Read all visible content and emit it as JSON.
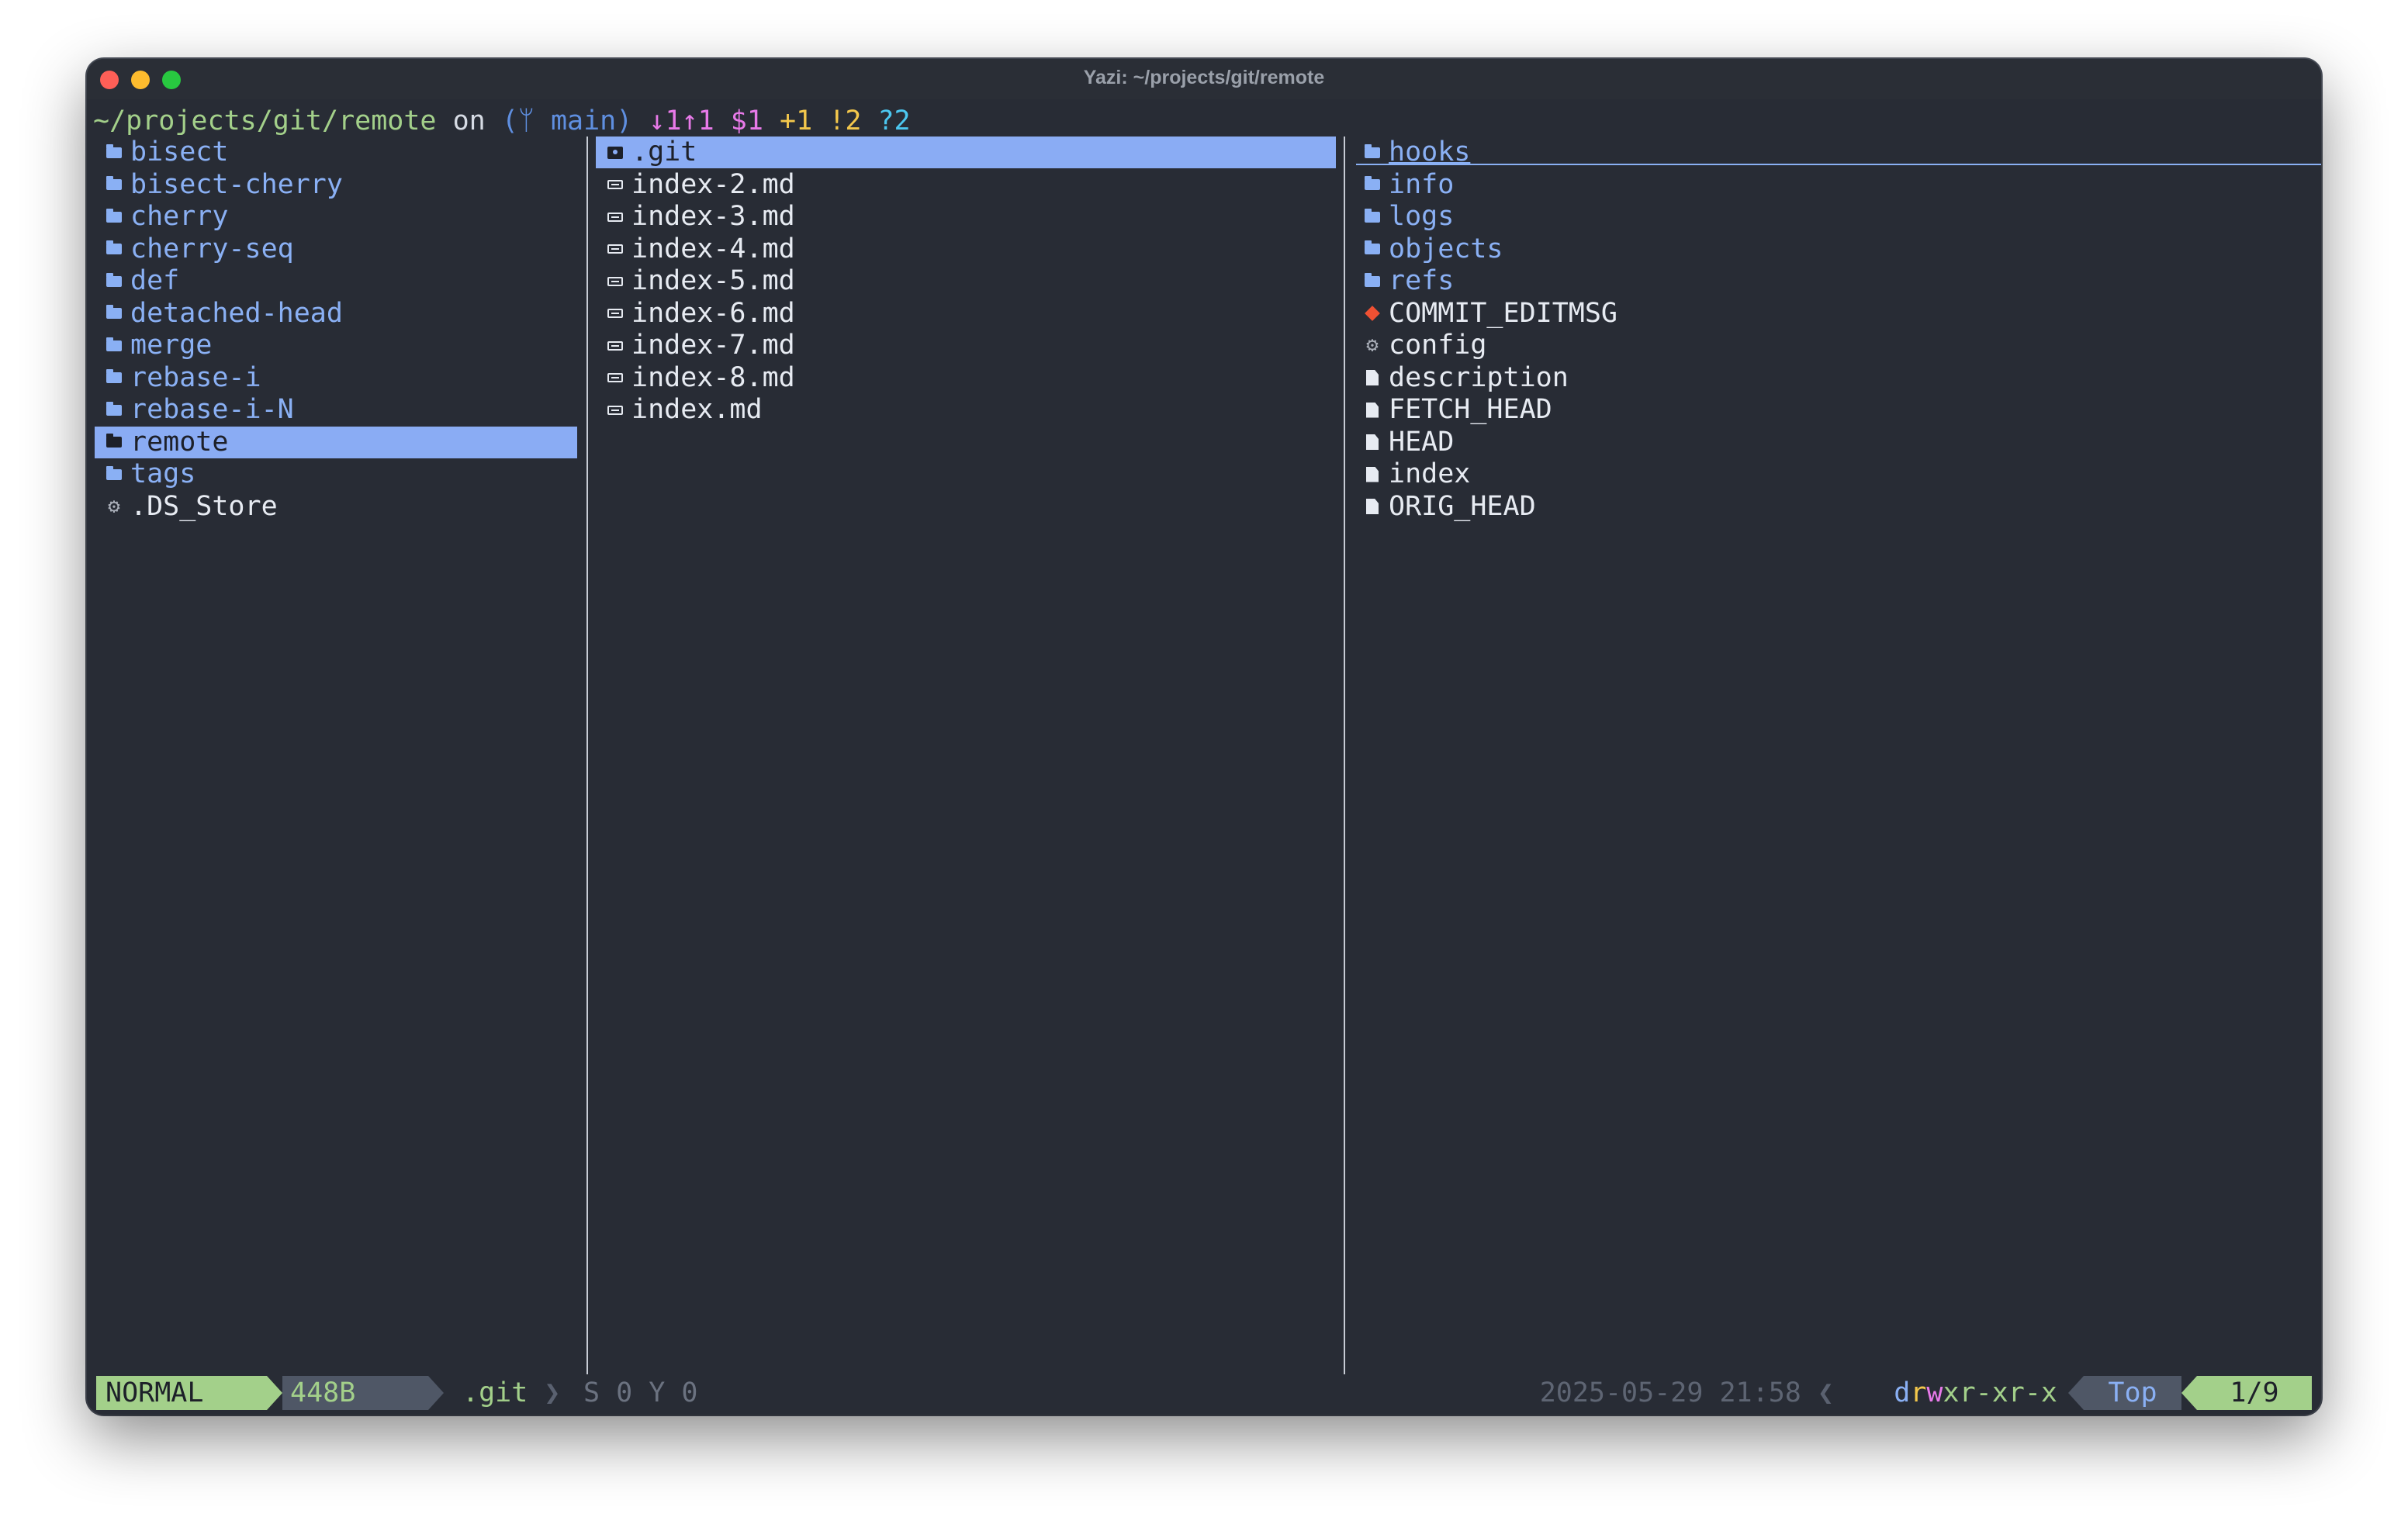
{
  "window": {
    "title": "Yazi: ~/projects/git/remote"
  },
  "prompt": {
    "path": "~/projects/git/remote",
    "on": " on ",
    "branch": "(ᛘ main)",
    "behind_ahead": "↓1↑1",
    "stash": "$1",
    "staged": "+1",
    "modified": "!2",
    "untracked": "?2"
  },
  "parent": {
    "items": [
      {
        "label": "bisect",
        "kind": "dir"
      },
      {
        "label": "bisect-cherry",
        "kind": "dir"
      },
      {
        "label": "cherry",
        "kind": "dir"
      },
      {
        "label": "cherry-seq",
        "kind": "dir"
      },
      {
        "label": "def",
        "kind": "dir"
      },
      {
        "label": "detached-head",
        "kind": "dir"
      },
      {
        "label": "merge",
        "kind": "dir"
      },
      {
        "label": "rebase-i",
        "kind": "dir"
      },
      {
        "label": "rebase-i-N",
        "kind": "dir"
      },
      {
        "label": "remote",
        "kind": "dir",
        "selected": true
      },
      {
        "label": "tags",
        "kind": "dir"
      },
      {
        "label": ".DS_Store",
        "kind": "gear"
      }
    ]
  },
  "current": {
    "items": [
      {
        "label": ".git",
        "kind": "gitdir",
        "selected": true
      },
      {
        "label": "index-2.md",
        "kind": "md"
      },
      {
        "label": "index-3.md",
        "kind": "md"
      },
      {
        "label": "index-4.md",
        "kind": "md"
      },
      {
        "label": "index-5.md",
        "kind": "md"
      },
      {
        "label": "index-6.md",
        "kind": "md"
      },
      {
        "label": "index-7.md",
        "kind": "md"
      },
      {
        "label": "index-8.md",
        "kind": "md"
      },
      {
        "label": "index.md",
        "kind": "md"
      }
    ]
  },
  "preview": {
    "items": [
      {
        "label": "hooks",
        "kind": "dir"
      },
      {
        "label": "info",
        "kind": "dir"
      },
      {
        "label": "logs",
        "kind": "dir"
      },
      {
        "label": "objects",
        "kind": "dir"
      },
      {
        "label": "refs",
        "kind": "dir"
      },
      {
        "label": "COMMIT_EDITMSG",
        "kind": "git"
      },
      {
        "label": "config",
        "kind": "gear"
      },
      {
        "label": "description",
        "kind": "doc"
      },
      {
        "label": "FETCH_HEAD",
        "kind": "doc"
      },
      {
        "label": "HEAD",
        "kind": "doc"
      },
      {
        "label": "index",
        "kind": "doc"
      },
      {
        "label": "ORIG_HEAD",
        "kind": "doc"
      }
    ]
  },
  "status": {
    "mode": "NORMAL",
    "size": "448B",
    "name": ".git",
    "sep": "❯",
    "selection": "S 0 Y 0",
    "datetime": "2025-05-29 21:58",
    "left_sep": "❮",
    "perm_d": "d",
    "perm_r1": "r",
    "perm_w": "w",
    "perm_x1": "x",
    "perm_rest": "r-xr-x",
    "position": "Top",
    "counter": "1/9"
  },
  "colors": {
    "background": "#282c35",
    "selection": "#8aacf4",
    "directory": "#8ab0f4",
    "green": "#a3d08a"
  }
}
